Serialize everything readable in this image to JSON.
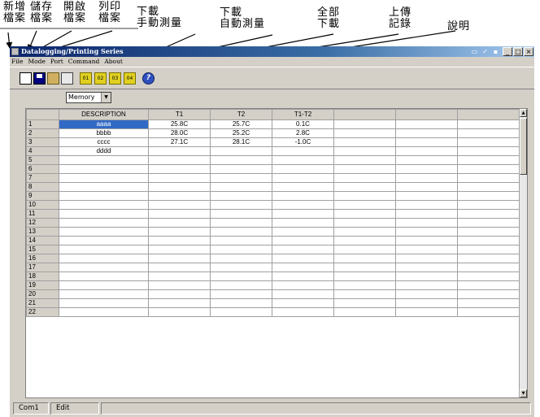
{
  "annotations": [
    {
      "text": "新增\n檔案"
    },
    {
      "text": "儲存\n檔案"
    },
    {
      "text": "開啟\n檔案"
    },
    {
      "text": "列印\n檔案"
    },
    {
      "text": "下載\n手動測量"
    },
    {
      "text": "下載\n自動測量"
    },
    {
      "text": "全部\n下載"
    },
    {
      "text": "上傳\n記錄"
    },
    {
      "text": "說明"
    }
  ],
  "window": {
    "title": "Datalogging/Printing Series",
    "menu": [
      "File",
      "Mode",
      "Port",
      "Command",
      "About"
    ],
    "titlebar_buttons": [
      "_",
      "□",
      "×"
    ]
  },
  "toolbar": {
    "icons": [
      "new-file-icon",
      "save-icon",
      "open-file-icon",
      "print-icon",
      "download-manual-icon",
      "download-auto-icon",
      "download-all-icon",
      "upload-record-icon",
      "help-icon"
    ],
    "download_labels": [
      "01",
      "02",
      "03",
      "04"
    ],
    "help_label": "?"
  },
  "memory_select": {
    "value": "Memory"
  },
  "grid": {
    "columns": [
      "",
      "DESCRIPTION",
      "T1",
      "T2",
      "T1-T2",
      "",
      "",
      ""
    ],
    "rows": [
      [
        "1",
        "aaaa",
        "25.8C",
        "25.7C",
        "0.1C"
      ],
      [
        "2",
        "bbbb",
        "28.0C",
        "25.2C",
        "2.8C"
      ],
      [
        "3",
        "cccc",
        "27.1C",
        "28.1C",
        "-1.0C"
      ],
      [
        "4",
        "dddd",
        "",
        "",
        ""
      ],
      [
        "5",
        "",
        "",
        "",
        ""
      ],
      [
        "6",
        "",
        "",
        "",
        ""
      ],
      [
        "7",
        "",
        "",
        "",
        ""
      ],
      [
        "8",
        "",
        "",
        "",
        ""
      ],
      [
        "9",
        "",
        "",
        "",
        ""
      ],
      [
        "10",
        "",
        "",
        "",
        ""
      ],
      [
        "11",
        "",
        "",
        "",
        ""
      ],
      [
        "12",
        "",
        "",
        "",
        ""
      ],
      [
        "13",
        "",
        "",
        "",
        ""
      ],
      [
        "14",
        "",
        "",
        "",
        ""
      ],
      [
        "15",
        "",
        "",
        "",
        ""
      ],
      [
        "16",
        "",
        "",
        "",
        ""
      ],
      [
        "17",
        "",
        "",
        "",
        ""
      ],
      [
        "18",
        "",
        "",
        "",
        ""
      ],
      [
        "19",
        "",
        "",
        "",
        ""
      ],
      [
        "20",
        "",
        "",
        "",
        ""
      ],
      [
        "21",
        "",
        "",
        "",
        ""
      ],
      [
        "22",
        "",
        "",
        "",
        ""
      ]
    ]
  },
  "status": {
    "port": "Com1",
    "mode": "Edit"
  }
}
